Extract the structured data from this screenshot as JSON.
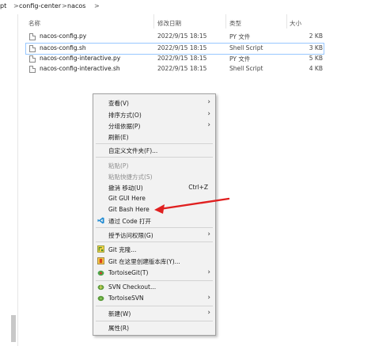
{
  "breadcrumb": {
    "items": [
      "pt",
      "config-center",
      "nacos"
    ],
    "separator": ">"
  },
  "columns": {
    "name": "名称",
    "date": "修改日期",
    "type": "类型",
    "size": "大小"
  },
  "files": [
    {
      "name": "nacos-config.py",
      "date": "2022/9/15 18:15",
      "type": "PY 文件",
      "size": "2 KB",
      "selected": false
    },
    {
      "name": "nacos-config.sh",
      "date": "2022/9/15 18:15",
      "type": "Shell Script",
      "size": "3 KB",
      "selected": true
    },
    {
      "name": "nacos-config-interactive.py",
      "date": "2022/9/15 18:15",
      "type": "PY 文件",
      "size": "5 KB",
      "selected": false
    },
    {
      "name": "nacos-config-interactive.sh",
      "date": "2022/9/15 18:15",
      "type": "Shell Script",
      "size": "4 KB",
      "selected": false
    }
  ],
  "context_menu": {
    "items": [
      {
        "label": "查看(V)",
        "submenu": true
      },
      {
        "label": "排序方式(O)",
        "submenu": true
      },
      {
        "label": "分组依据(P)",
        "submenu": true
      },
      {
        "label": "刷新(E)"
      },
      {
        "label": "自定义文件夹(F)..."
      },
      {
        "label": "粘贴(P)",
        "disabled": true
      },
      {
        "label": "粘贴快捷方式(S)",
        "disabled": true
      },
      {
        "label": "撤消 移动(U)",
        "shortcut": "Ctrl+Z"
      },
      {
        "label": "Git GUI Here"
      },
      {
        "label": "Git Bash Here"
      },
      {
        "label": "通过 Code 打开",
        "icon": "vscode-icon"
      },
      {
        "label": "授予访问权限(G)",
        "submenu": true
      },
      {
        "label": "Git 克隆...",
        "icon": "git-clone-icon"
      },
      {
        "label": "Git 在这里创建版本库(Y)...",
        "icon": "git-create-repo-icon"
      },
      {
        "label": "TortoiseGit(T)",
        "icon": "tortoisegit-icon",
        "submenu": true
      },
      {
        "label": "SVN Checkout...",
        "icon": "svn-checkout-icon"
      },
      {
        "label": "TortoiseSVN",
        "icon": "tortoisesvn-icon",
        "submenu": true
      },
      {
        "label": "新建(W)",
        "submenu": true
      },
      {
        "label": "属性(R)"
      }
    ]
  },
  "colors": {
    "selection_border": "#99c8ff",
    "menu_bg": "#f2f2f2",
    "annotation_arrow": "#e02020"
  }
}
